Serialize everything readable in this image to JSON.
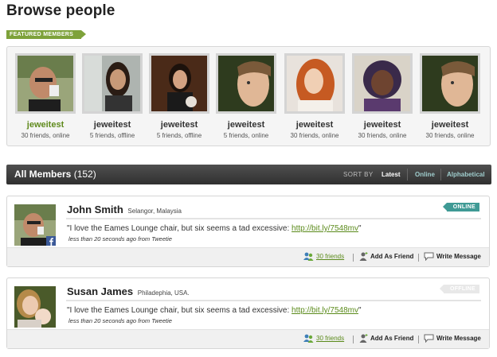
{
  "page": {
    "title": "Browse people"
  },
  "featured": {
    "tag": "FEATURED MEMBERS",
    "members": [
      {
        "name": "jeweitest",
        "meta": "30 friends, online",
        "active": true
      },
      {
        "name": "jeweitest",
        "meta": "5 friends, offline",
        "active": false
      },
      {
        "name": "jeweitest",
        "meta": "5 friends, offline",
        "active": false
      },
      {
        "name": "jeweitest",
        "meta": "5 friends, online",
        "active": false
      },
      {
        "name": "jeweitest",
        "meta": "30 friends, online",
        "active": false
      },
      {
        "name": "jeweitest",
        "meta": "30 friends, online",
        "active": false
      },
      {
        "name": "jeweitest",
        "meta": "30 friends, online",
        "active": false
      }
    ]
  },
  "members_bar": {
    "title": "All Members",
    "count": "(152)",
    "sort_label": "SORT BY",
    "sort_options": [
      "Latest",
      "Online",
      "Alphabetical"
    ],
    "active_sort": "Latest"
  },
  "members": [
    {
      "name": "John Smith",
      "location": "Selangor, Malaysia",
      "status_badge": "ONLINE",
      "online": true,
      "status_prefix": "\"I love the Eames Lounge chair, but six seems a tad excessive: ",
      "status_link": "http://bit.ly/7548mv",
      "status_suffix": "\"",
      "status_meta": "less than 20 seconds ago from Tweetie",
      "friends": "30 friends",
      "add_friend": "Add As Friend",
      "write_message": "Write Message"
    },
    {
      "name": "Susan James",
      "location": "Philadephia, USA.",
      "status_badge": "OFFLINE",
      "online": false,
      "status_prefix": "\"I love the Eames Lounge chair, but six seems a tad excessive: ",
      "status_link": "http://bit.ly/7548mv",
      "status_suffix": "\"",
      "status_meta": "less than 20 seconds ago from Tweetie",
      "friends": "30 friends",
      "add_friend": "Add As Friend",
      "write_message": "Write Message"
    }
  ],
  "colors": {
    "accent_green": "#7ea23a",
    "link_green": "#5a8a1a",
    "online_teal": "#3f9a95",
    "bar_dark": "#3a3a3a"
  },
  "icons": {
    "friends": "people-icon",
    "add_friend": "person-add-icon",
    "message": "speech-bubble-icon",
    "facebook": "facebook-icon"
  }
}
